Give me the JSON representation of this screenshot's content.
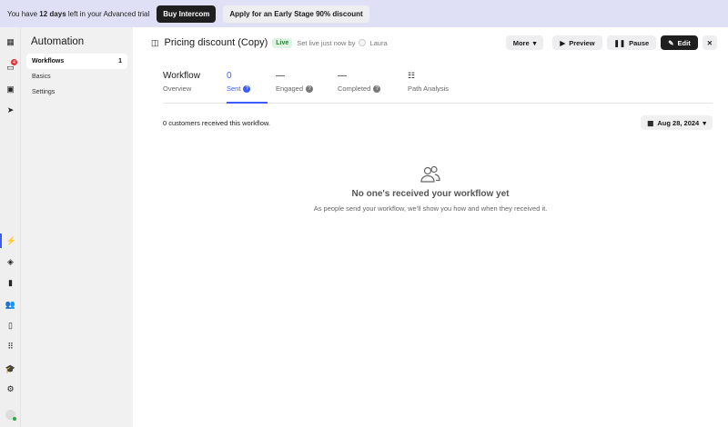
{
  "banner": {
    "prefix": "You have ",
    "days": "12 days",
    "suffix": " left in your Advanced trial",
    "buy": "Buy Intercom",
    "discount": "Apply for an Early Stage 90% discount"
  },
  "rail": {
    "inbox_badge": "4",
    "accent": "#3b5bfd",
    "items": [
      "intercom-logo",
      "inbox",
      "contacts",
      "outbound",
      "automation",
      "layers",
      "reports",
      "people",
      "knowledge",
      "apps",
      "academy",
      "settings",
      "user"
    ]
  },
  "sidebar": {
    "title": "Automation",
    "items": [
      {
        "label": "Workflows",
        "count": "1"
      },
      {
        "label": "Basics"
      },
      {
        "label": "Settings"
      }
    ]
  },
  "header": {
    "title": "Pricing discount (Copy)",
    "status": "Live",
    "set_live": "Set live just now by",
    "user": "Laura",
    "more": "More",
    "preview": "Preview",
    "pause": "Pause",
    "edit": "Edit"
  },
  "tabs": [
    {
      "value": "Workflow",
      "label": "Overview"
    },
    {
      "value": "0",
      "label": "Sent"
    },
    {
      "value": "—",
      "label": "Engaged"
    },
    {
      "value": "—",
      "label": "Completed"
    },
    {
      "value": "",
      "label": "Path Analysis"
    }
  ],
  "content": {
    "count_text": "0 customers received this workflow.",
    "date": "Aug 28, 2024",
    "empty_title": "No one's received your workflow yet",
    "empty_text": "As people send your workflow, we'll show you how and when they received it."
  }
}
